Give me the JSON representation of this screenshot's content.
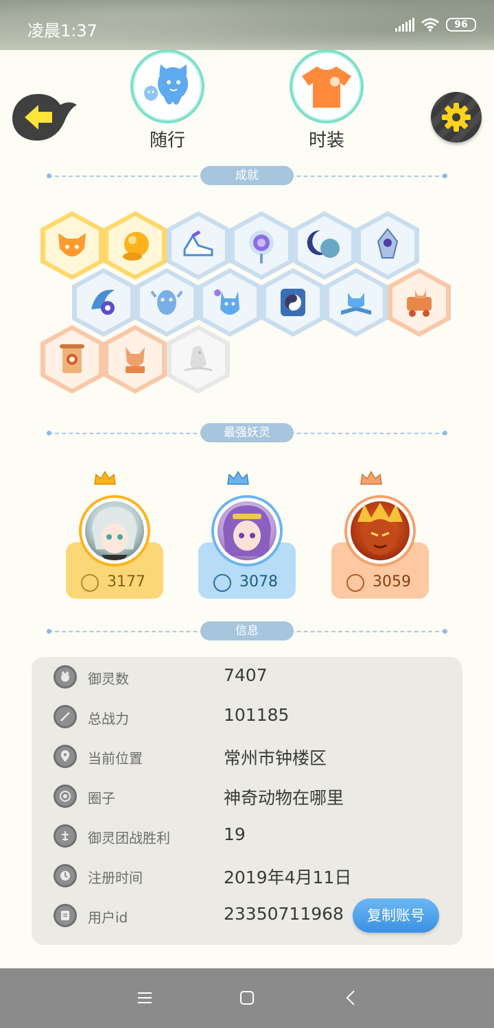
{
  "status_bar": {
    "time": "凌晨1:37",
    "battery": "96"
  },
  "header": {
    "back_icon": "back-arrow-icon",
    "settings_icon": "gear-icon",
    "tabs": [
      {
        "label": "随行",
        "icon": "companion-ghost-icon"
      },
      {
        "label": "时装",
        "icon": "tshirt-icon"
      }
    ]
  },
  "achievements": {
    "title": "成就",
    "badges": [
      {
        "name": "fox-face-badge",
        "tier": "gold"
      },
      {
        "name": "golden-orb-badge",
        "tier": "gold"
      },
      {
        "name": "sneaker-badge",
        "tier": "blue"
      },
      {
        "name": "lollipop-badge",
        "tier": "blue"
      },
      {
        "name": "moon-badge",
        "tier": "blue"
      },
      {
        "name": "crystal-badge",
        "tier": "blue"
      },
      {
        "name": "wave-taiji-badge",
        "tier": "blue"
      },
      {
        "name": "spirit-badge",
        "tier": "blue"
      },
      {
        "name": "ghost-cat-badge",
        "tier": "blue"
      },
      {
        "name": "taiji-block-badge",
        "tier": "blue"
      },
      {
        "name": "book-fox-badge",
        "tier": "blue"
      },
      {
        "name": "cart-cat-badge",
        "tier": "orange"
      },
      {
        "name": "scroll-badge",
        "tier": "orange"
      },
      {
        "name": "demon-badge",
        "tier": "orange"
      },
      {
        "name": "locked-creature-badge",
        "tier": "gray"
      }
    ]
  },
  "strongest": {
    "title": "最强妖灵",
    "spirits": [
      {
        "power": "3177",
        "color": "#fcd777",
        "text_color": "#b8862a"
      },
      {
        "power": "3078",
        "color": "#b6dcf7",
        "text_color": "#2d6da3"
      },
      {
        "power": "3059",
        "color": "#fcc9a3",
        "text_color": "#b65a2a"
      }
    ]
  },
  "info": {
    "title": "信息",
    "rows": [
      {
        "icon": "spirit-count-icon",
        "label": "御灵数",
        "value": "7407"
      },
      {
        "icon": "sword-icon",
        "label": "总战力",
        "value": "101185"
      },
      {
        "icon": "location-pin-icon",
        "label": "当前位置",
        "value": "常州市钟楼区"
      },
      {
        "icon": "circle-group-icon",
        "label": "圈子",
        "value": "神奇动物在哪里"
      },
      {
        "icon": "team-battle-icon",
        "label": "御灵团战胜利",
        "value": "19"
      },
      {
        "icon": "clock-icon",
        "label": "注册时间",
        "value": "2019年4月11日"
      },
      {
        "icon": "id-card-icon",
        "label": "用户id",
        "value": "23350711968"
      }
    ],
    "copy_button": "复制账号"
  },
  "nav": {
    "menu_icon": "menu-icon",
    "home_icon": "home-square-icon",
    "back_icon": "back-chevron-icon"
  }
}
